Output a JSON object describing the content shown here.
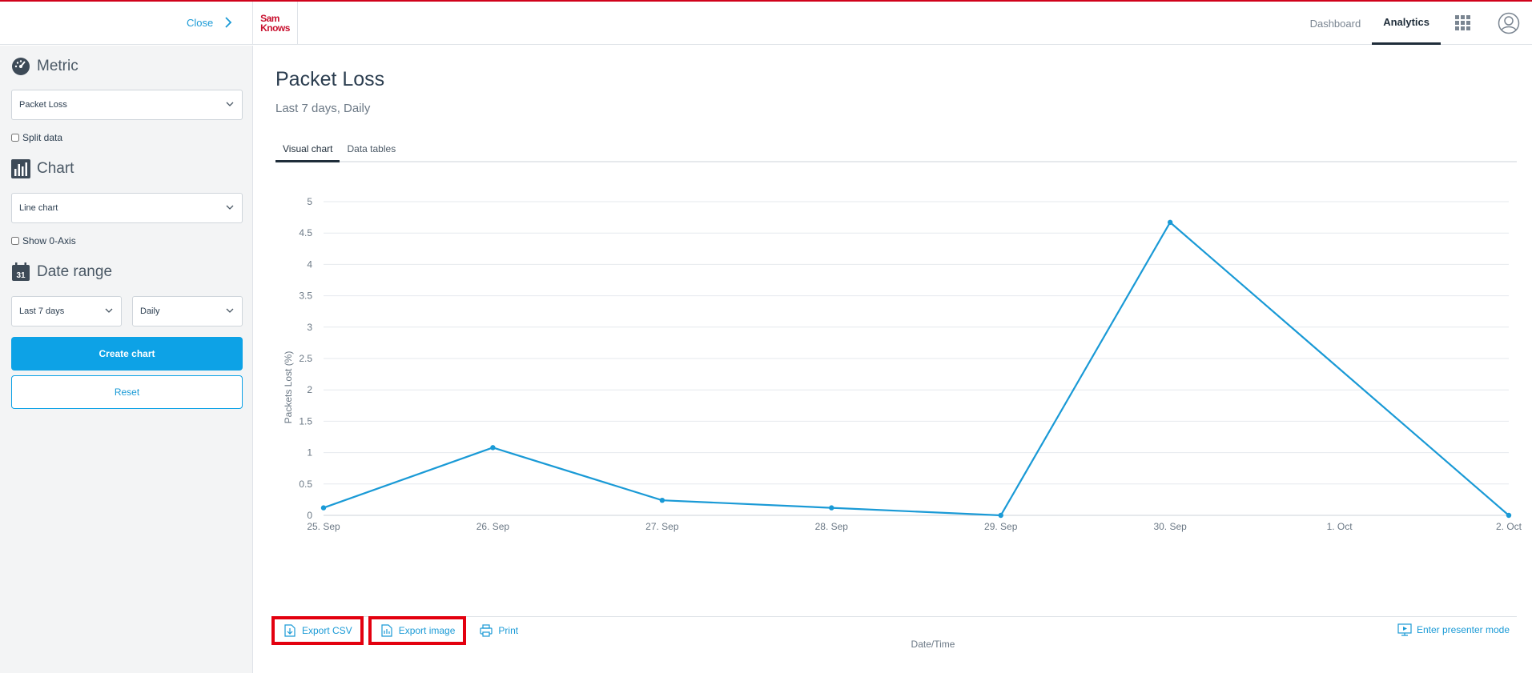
{
  "header": {
    "close_label": "Close",
    "logo_line1": "Sam",
    "logo_line2": "Knows",
    "nav": [
      "Dashboard",
      "Analytics"
    ],
    "active_nav": "Analytics"
  },
  "sidebar": {
    "metric_title": "Metric",
    "metric_value": "Packet Loss",
    "split_data_label": "Split data",
    "chart_title": "Chart",
    "chart_value": "Line chart",
    "show_zero_axis_label": "Show 0-Axis",
    "date_range_title": "Date range",
    "calendar_day": "31",
    "range_value": "Last 7 days",
    "granularity_value": "Daily",
    "create_label": "Create chart",
    "reset_label": "Reset"
  },
  "main": {
    "title": "Packet Loss",
    "subtitle": "Last 7 days, Daily",
    "tabs": [
      "Visual chart",
      "Data tables"
    ],
    "actions": {
      "export_csv": "Export CSV",
      "export_image": "Export image",
      "print": "Print",
      "presenter": "Enter presenter mode"
    }
  },
  "colors": {
    "accent": "#0da2e6",
    "line": "#1a9ad6",
    "brand": "#c8102e",
    "highlight": "#e3000f"
  },
  "chart_data": {
    "type": "line",
    "categories": [
      "25. Sep",
      "26. Sep",
      "27. Sep",
      "28. Sep",
      "29. Sep",
      "30. Sep",
      "1. Oct",
      "2. Oct"
    ],
    "x": [
      0,
      1,
      2,
      3,
      4,
      5,
      7
    ],
    "values": [
      0.12,
      1.08,
      0.24,
      0.12,
      0,
      4.67,
      0
    ],
    "xlabel": "Date/Time",
    "ylabel": "Packets Lost (%)",
    "ylim": [
      0,
      5
    ],
    "yticks": [
      "0",
      "0.5",
      "1",
      "1.5",
      "2",
      "2.5",
      "3",
      "3.5",
      "4",
      "4.5",
      "5"
    ],
    "grid": true
  }
}
